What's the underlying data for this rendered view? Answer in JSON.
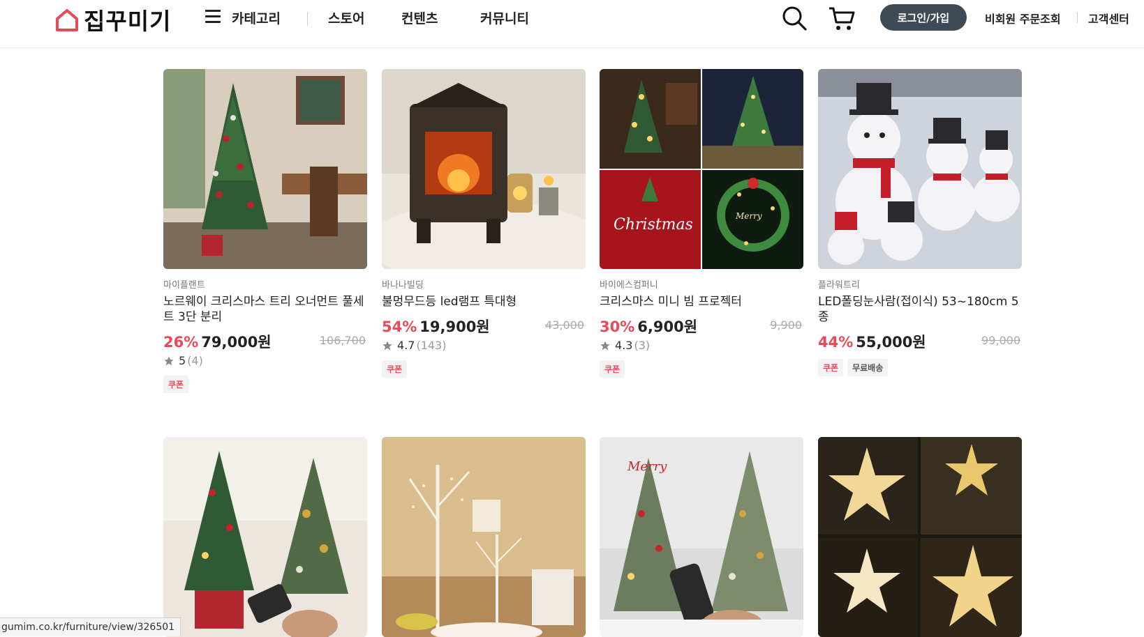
{
  "header": {
    "logo_text": "집꾸미기",
    "nav": {
      "category": "카테고리",
      "store": "스토어",
      "contents": "컨텐츠",
      "community": "커뮤니티"
    },
    "login_label": "로그인/가입",
    "guest_order_label": "비회원 주문조회",
    "customer_center_label": "고객센터"
  },
  "products": [
    {
      "store": "마이플랜트",
      "name": "노르웨이 크리스마스 트리 오너먼트 풀세트 3단 분리",
      "discount": "26%",
      "price": "79,000원",
      "original_price": "106,700",
      "rating": "5",
      "reviews": "(4)",
      "badges": [
        "쿠폰"
      ]
    },
    {
      "store": "바나나빌딩",
      "name": "불멍무드등 led램프 특대형",
      "discount": "54%",
      "price": "19,900원",
      "original_price": "43,000",
      "rating": "4.7",
      "reviews": "(143)",
      "badges": [
        "쿠폰"
      ]
    },
    {
      "store": "바이에스컴퍼니",
      "name": "크리스마스 미니 빔 프로젝터",
      "discount": "30%",
      "price": "6,900원",
      "original_price": "9,900",
      "rating": "4.3",
      "reviews": "(3)",
      "badges": [
        "쿠폰"
      ]
    },
    {
      "store": "플라워트리",
      "name": "LED폴딩눈사람(접이식) 53~180cm 5종",
      "discount": "44%",
      "price": "55,000원",
      "original_price": "99,000",
      "rating": "",
      "reviews": "",
      "badges": [
        "쿠폰",
        "무료배송"
      ]
    }
  ],
  "status_bar": {
    "url": "gumim.co.kr/furniture/view/326501"
  },
  "colors": {
    "accent": "#e84a58",
    "login_bg": "#3f4b54"
  }
}
